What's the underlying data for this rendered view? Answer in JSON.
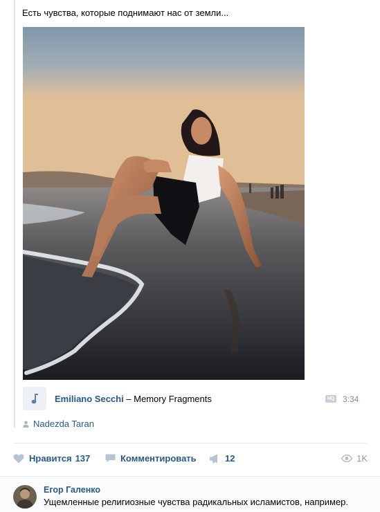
{
  "post": {
    "text": "Есть чувства, которые поднимают нас от земли..."
  },
  "audio": {
    "artist": "Emiliano Secchi",
    "separator": " – ",
    "title": "Memory Fragments",
    "quality_badge": "HQ",
    "duration": "3:34",
    "icon": "music-note-icon"
  },
  "source_author": {
    "name": "Nadezda Taran",
    "icon": "person-icon"
  },
  "actions": {
    "like_label": "Нравится",
    "like_count": "137",
    "comment_label": "Комментировать",
    "share_count": "12",
    "views": "1K"
  },
  "comment": {
    "author": "Егор Галенко",
    "text": "Ущемленные религиозные чувства радикальных исламистов, например."
  },
  "colors": {
    "link": "#2a5885",
    "muted": "#828a99",
    "divider": "#e7e8ec"
  }
}
